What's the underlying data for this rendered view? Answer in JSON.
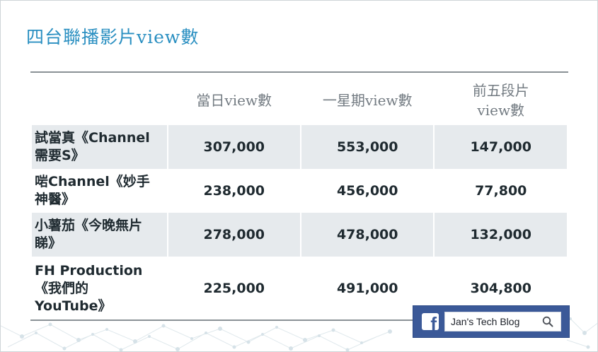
{
  "title": "四台聯播影片view數",
  "table": {
    "headers": [
      "",
      "當日view數",
      "一星期view數",
      "前五段片\nview數"
    ],
    "rows": [
      {
        "name_lines": [
          "試當真《Channel",
          "需要S》"
        ],
        "daily": "307,000",
        "weekly": "553,000",
        "top5": "147,000"
      },
      {
        "name_lines": [
          "啱Channel《妙手",
          "神醫》"
        ],
        "daily": "238,000",
        "weekly": "456,000",
        "top5": "77,800"
      },
      {
        "name_lines": [
          "小薯茄《今晚無片",
          "睇》"
        ],
        "daily": "278,000",
        "weekly": "478,000",
        "top5": "132,000"
      },
      {
        "name_lines": [
          "FH Production",
          "《我們的",
          "YouTube》"
        ],
        "daily": "225,000",
        "weekly": "491,000",
        "top5": "304,800"
      }
    ]
  },
  "footer": {
    "fb_logo": "f",
    "search_text": "Jan's Tech Blog",
    "icon": "search-icon",
    "fb_color": "#3b5998"
  },
  "colors": {
    "title": "#2a8fc1",
    "row_shade": "#e6eaed"
  }
}
